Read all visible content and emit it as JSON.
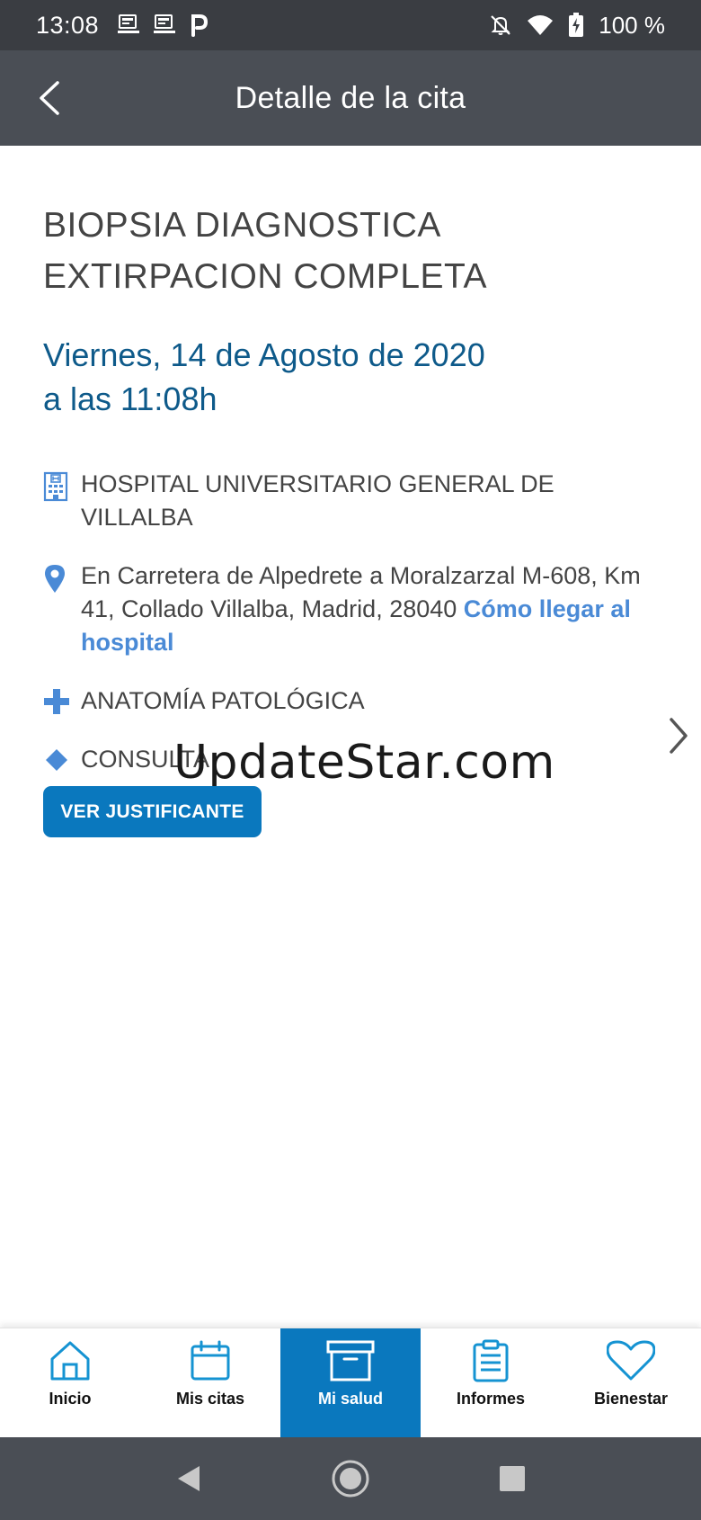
{
  "status_bar": {
    "time": "13:08",
    "battery_percent": "100 %",
    "notification_icons": [
      "saludmadrid-icon",
      "saludmadrid-icon",
      "parking-p-icon"
    ],
    "system_icons": [
      "bell-off-icon",
      "wifi-icon",
      "battery-charging-icon"
    ]
  },
  "header": {
    "title": "Detalle de la cita",
    "back_icon": "chevron-left-icon"
  },
  "appointment": {
    "procedure_line1": "BIOPSIA DIAGNOSTICA",
    "procedure_line2": "EXTIRPACION COMPLETA",
    "date_line1": "Viernes, 14 de Agosto de 2020",
    "date_line2": "a las 11:08h",
    "hospital": "HOSPITAL UNIVERSITARIO GENERAL DE VILLALBA",
    "address": "En Carretera de Alpedrete a Moralzarzal M-608, Km 41, Collado Villalba, Madrid, 28040",
    "directions_link": "Cómo llegar al hospital",
    "service": "ANATOMÍA PATOLÓGICA",
    "type": "CONSULTA"
  },
  "actions": {
    "justificante_label": "VER JUSTIFICANTE"
  },
  "watermark": "UpdateStar.com",
  "bottom_nav": {
    "items": [
      {
        "label": "Inicio",
        "icon": "home-icon"
      },
      {
        "label": "Mis citas",
        "icon": "calendar-icon"
      },
      {
        "label": "Mi salud",
        "icon": "archive-box-icon",
        "active": true
      },
      {
        "label": "Informes",
        "icon": "clipboard-icon"
      },
      {
        "label": "Bienestar",
        "icon": "heart-icon"
      }
    ]
  },
  "colors": {
    "accent": "#0a78be",
    "date_text": "#0e5a8a",
    "link": "#4a8ad6",
    "icon_blue": "#4a8ad6",
    "header_bg": "#4a4e55",
    "status_bg": "#3a3d42"
  }
}
